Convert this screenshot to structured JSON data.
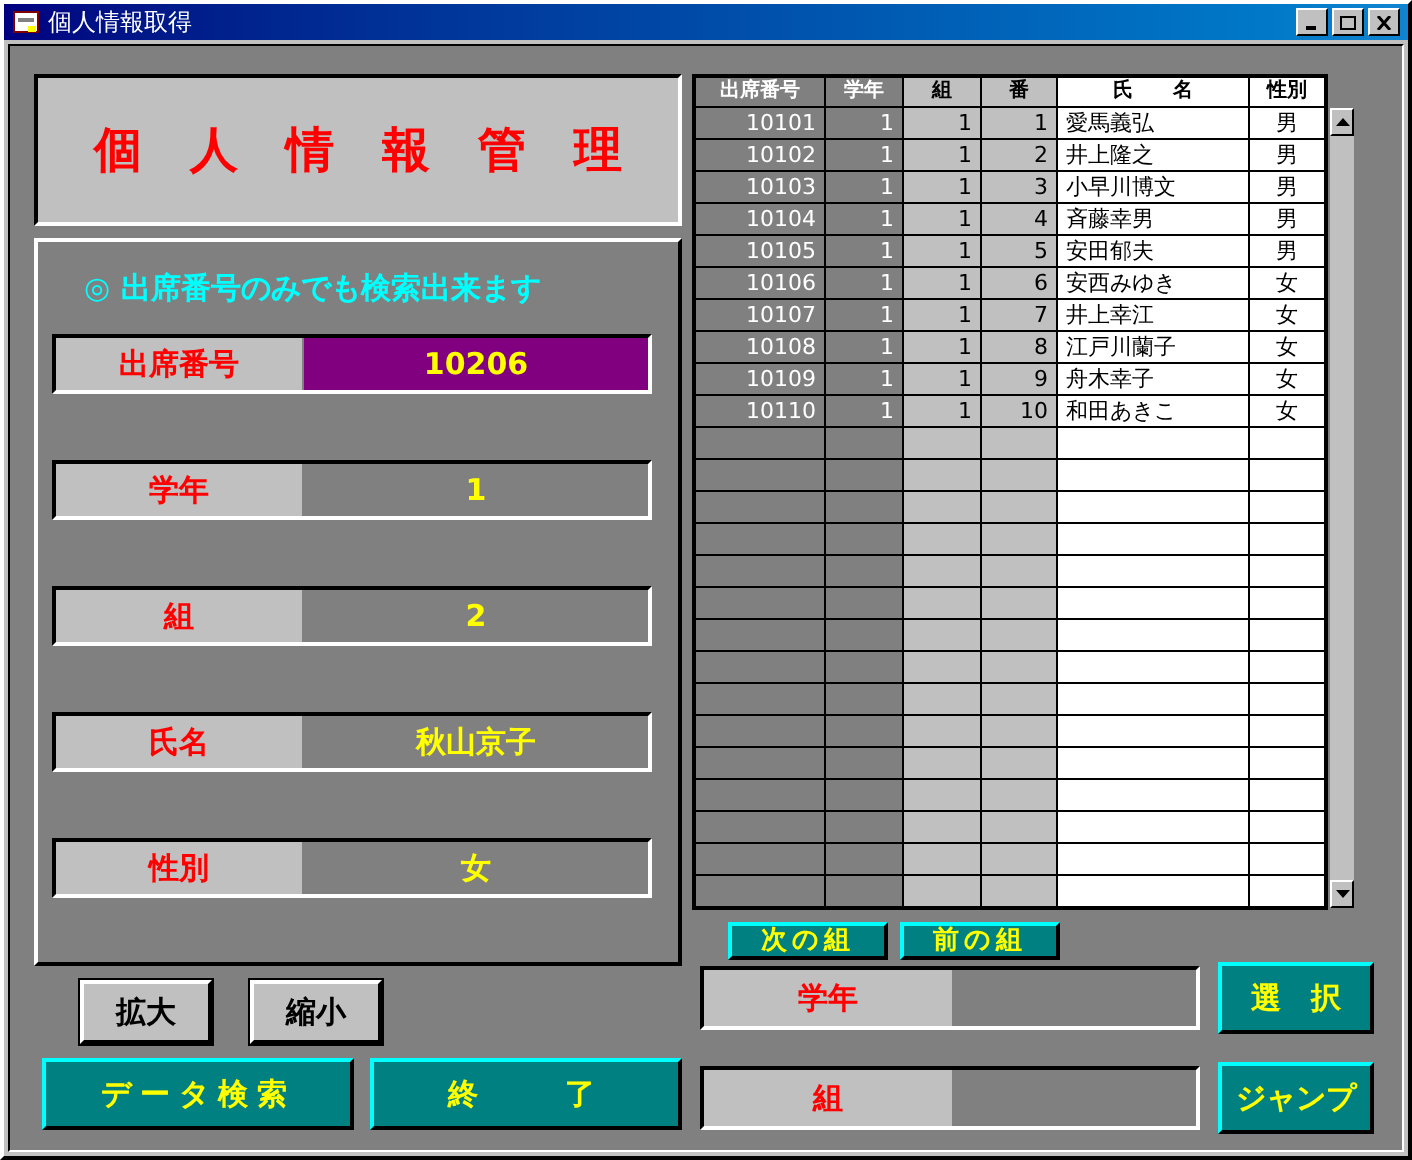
{
  "window": {
    "title": "個人情報取得"
  },
  "heading": [
    "個",
    "人",
    "情",
    "報",
    "管",
    "理"
  ],
  "hint": "◎ 出席番号のみでも検索出来ます",
  "fields": [
    {
      "label": "出席番号",
      "value": "10206",
      "focused": true
    },
    {
      "label": "学年",
      "value": "1",
      "focused": false
    },
    {
      "label": "組",
      "value": "2",
      "focused": false
    },
    {
      "label": "氏名",
      "value": "秋山京子",
      "focused": false
    },
    {
      "label": "性別",
      "value": "女",
      "focused": false
    }
  ],
  "zoom_buttons": [
    "拡大",
    "縮小"
  ],
  "action_buttons": [
    "データ検索",
    "終　　了"
  ],
  "table": {
    "columns": [
      "出席番号",
      "学年",
      "組",
      "番",
      "氏　　名",
      "性別"
    ],
    "rows": [
      [
        "10101",
        "1",
        "1",
        "1",
        "愛馬義弘",
        "男"
      ],
      [
        "10102",
        "1",
        "1",
        "2",
        "井上隆之",
        "男"
      ],
      [
        "10103",
        "1",
        "1",
        "3",
        "小早川博文",
        "男"
      ],
      [
        "10104",
        "1",
        "1",
        "4",
        "斉藤幸男",
        "男"
      ],
      [
        "10105",
        "1",
        "1",
        "5",
        "安田郁夫",
        "男"
      ],
      [
        "10106",
        "1",
        "1",
        "6",
        "安西みゆき",
        "女"
      ],
      [
        "10107",
        "1",
        "1",
        "7",
        "井上幸江",
        "女"
      ],
      [
        "10108",
        "1",
        "1",
        "8",
        "江戸川蘭子",
        "女"
      ],
      [
        "10109",
        "1",
        "1",
        "9",
        "舟木幸子",
        "女"
      ],
      [
        "10110",
        "1",
        "1",
        "10",
        "和田あきこ",
        "女"
      ]
    ]
  },
  "group_nav": [
    "次の組",
    "前の組"
  ],
  "selectors": [
    {
      "label": "学年",
      "button": "選　択"
    },
    {
      "label": "組",
      "button": "ジャンプ"
    }
  ]
}
